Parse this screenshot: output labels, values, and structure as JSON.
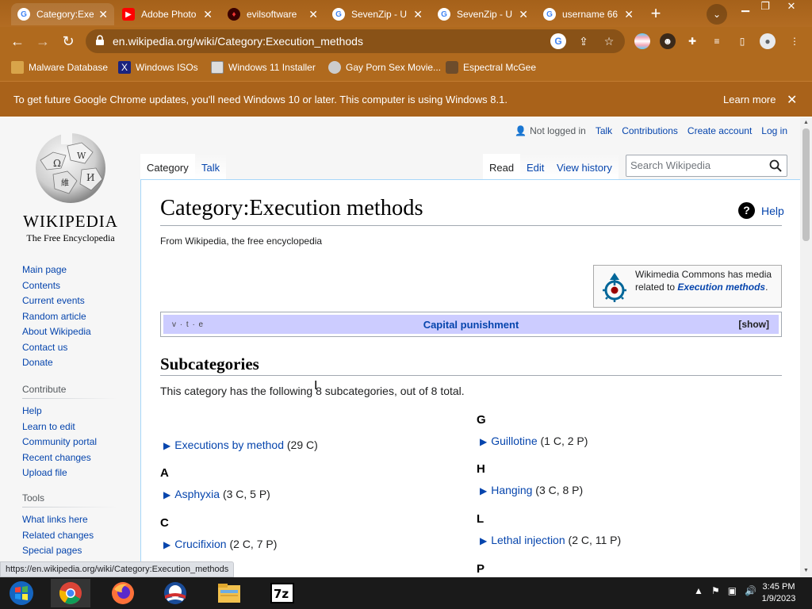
{
  "browser": {
    "tabs": [
      {
        "title": "Category:Exe",
        "active": true,
        "icon": "google-icon"
      },
      {
        "title": "Adobe Photo",
        "active": false,
        "icon": "youtube-icon"
      },
      {
        "title": "evilsoftware",
        "active": false,
        "icon": "evil-icon"
      },
      {
        "title": "SevenZip - U",
        "active": false,
        "icon": "google-icon"
      },
      {
        "title": "SevenZip - U",
        "active": false,
        "icon": "google-icon"
      },
      {
        "title": "username 66",
        "active": false,
        "icon": "google-icon"
      }
    ],
    "new_tab_glyph": "+",
    "url": "en.wikipedia.org/wiki/Category:Execution_methods",
    "bookmarks": [
      {
        "label": "Malware Database",
        "icon": "folder-icon"
      },
      {
        "label": "Windows ISOs",
        "icon": "x-icon"
      },
      {
        "label": "Windows 11 Installer",
        "icon": "image-icon"
      },
      {
        "label": "Gay Porn Sex Movie...",
        "icon": "globe-icon"
      },
      {
        "label": "Espectral McGee",
        "icon": "face-icon"
      }
    ],
    "infobar": {
      "message": "To get future Google Chrome updates, you'll need Windows 10 or later. This computer is using Windows 8.1.",
      "action": "Learn more"
    },
    "status_url": "https://en.wikipedia.org/wiki/Category:Execution_methods",
    "theme_color": "#b06a1e"
  },
  "wiki": {
    "wordmark": "WIKIPEDIA",
    "tagline": "The Free Encyclopedia",
    "nav_links": [
      "Main page",
      "Contents",
      "Current events",
      "Random article",
      "About Wikipedia",
      "Contact us",
      "Donate"
    ],
    "contribute": {
      "heading": "Contribute",
      "links": [
        "Help",
        "Learn to edit",
        "Community portal",
        "Recent changes",
        "Upload file"
      ]
    },
    "tools": {
      "heading": "Tools",
      "links": [
        "What links here",
        "Related changes",
        "Special pages"
      ]
    },
    "personal": {
      "not_logged_in": "Not logged in",
      "talk": "Talk",
      "contributions": "Contributions",
      "create_account": "Create account",
      "log_in": "Log in"
    },
    "tabs": {
      "category": "Category",
      "talk": "Talk",
      "read": "Read",
      "edit": "Edit",
      "view_history": "View history"
    },
    "search": {
      "placeholder": "Search Wikipedia"
    },
    "title": "Category:Execution methods",
    "help": "Help",
    "site_sub": "From Wikipedia, the free encyclopedia",
    "commons": {
      "text": "Wikimedia Commons has media related to",
      "link": "Execution methods",
      "suffix": "."
    },
    "navbox": {
      "vte": "v · t · e",
      "title": "Capital punishment",
      "show": "[show]"
    },
    "subcategories": {
      "heading": "Subcategories",
      "description": "This category has the following 8 subcategories, out of 8 total."
    },
    "columns": [
      {
        "groups": [
          {
            "letter": "",
            "items": [
              {
                "name": "Executions by method",
                "count": "(29 C)"
              }
            ]
          },
          {
            "letter": "A",
            "items": [
              {
                "name": "Asphyxia",
                "count": "(3 C, 5 P)"
              }
            ]
          },
          {
            "letter": "C",
            "items": [
              {
                "name": "Crucifixion",
                "count": "(2 C, 7 P)"
              }
            ]
          }
        ]
      },
      {
        "groups": [
          {
            "letter": "G",
            "items": [
              {
                "name": "Guillotine",
                "count": "(1 C, 2 P)"
              }
            ]
          },
          {
            "letter": "H",
            "items": [
              {
                "name": "Hanging",
                "count": "(3 C, 8 P)"
              }
            ]
          },
          {
            "letter": "L",
            "items": [
              {
                "name": "Lethal injection",
                "count": "(2 C, 11 P)"
              }
            ]
          },
          {
            "letter": "P",
            "items": []
          }
        ]
      }
    ]
  },
  "taskbar": {
    "apps": [
      "start-icon",
      "chrome-icon",
      "firefox-icon",
      "obama-icon",
      "file-explorer-icon",
      "7zip-icon"
    ],
    "time": "3:45 PM",
    "date": "1/9/2023"
  }
}
